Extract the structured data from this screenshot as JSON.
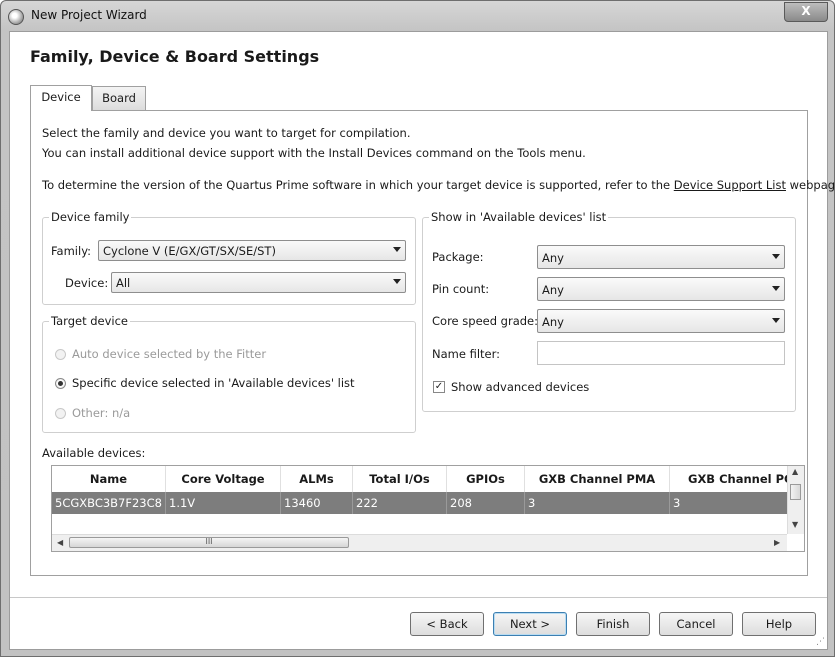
{
  "window": {
    "title": "New Project Wizard",
    "close_glyph": "X"
  },
  "page": {
    "heading": "Family, Device & Board Settings"
  },
  "tabs": [
    {
      "label": "Device"
    },
    {
      "label": "Board"
    }
  ],
  "intro": {
    "line1": "Select the family and device you want to target for compilation.",
    "line2": "You can install additional device support with the Install Devices command on the Tools menu.",
    "line3_prefix": "To determine the version of the Quartus Prime software in which your target device is supported, refer to the",
    "line3_link": "Device Support List",
    "line3_suffix": "webpage."
  },
  "device_family": {
    "title": "Device family",
    "family_label": "Family:",
    "family_value": "Cyclone V (E/GX/GT/SX/SE/ST)",
    "device_label": "Device:",
    "device_value": "All"
  },
  "target_device": {
    "title": "Target device",
    "options": [
      {
        "label": "Auto device selected by the Fitter",
        "checked": false,
        "enabled": false
      },
      {
        "label": "Specific device selected in 'Available devices' list",
        "checked": true,
        "enabled": true
      },
      {
        "label": "Other:  n/a",
        "checked": false,
        "enabled": false
      }
    ]
  },
  "show_in_list": {
    "title": "Show in 'Available devices' list",
    "package_label": "Package:",
    "package_value": "Any",
    "pin_count_label": "Pin count:",
    "pin_count_value": "Any",
    "speed_grade_label": "Core speed grade:",
    "speed_grade_value": "Any",
    "name_filter_label": "Name filter:",
    "name_filter_value": "",
    "show_advanced_label": "Show advanced devices",
    "show_advanced_checked": true
  },
  "available_devices": {
    "label": "Available devices:",
    "columns": [
      "Name",
      "Core Voltage",
      "ALMs",
      "Total I/Os",
      "GPIOs",
      "GXB Channel PMA",
      "GXB Channel PCS"
    ],
    "rows": [
      [
        "5CGXBC3B7F23C8",
        "1.1V",
        "13460",
        "222",
        "208",
        "3",
        "3"
      ]
    ],
    "hscroll_thumb_glyph": "III"
  },
  "buttons": {
    "back": "< Back",
    "next": "Next >",
    "finish": "Finish",
    "cancel": "Cancel",
    "help": "Help"
  }
}
